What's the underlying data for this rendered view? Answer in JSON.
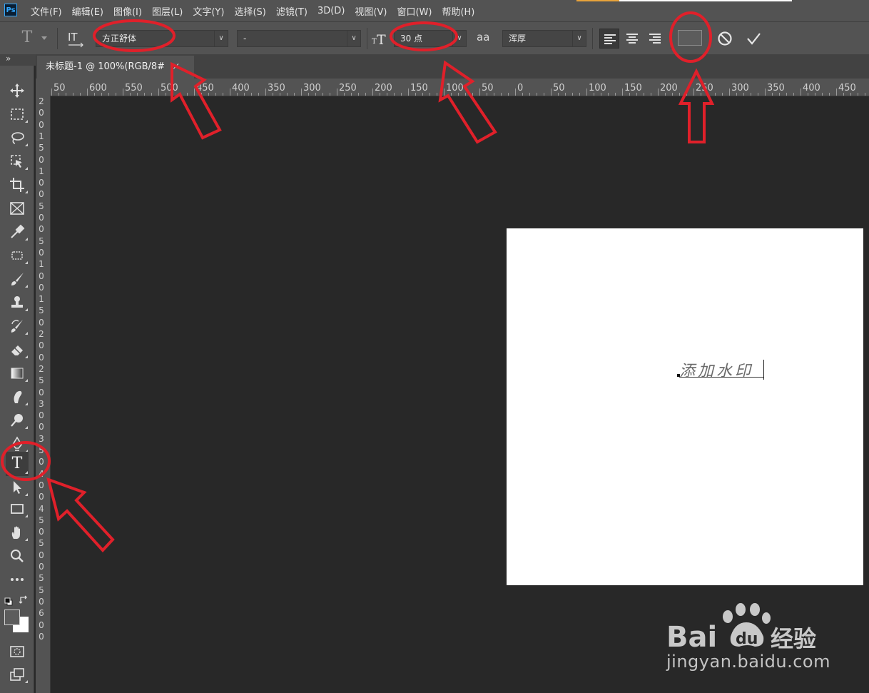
{
  "app": {
    "logo": "Ps"
  },
  "menu": {
    "items": [
      "文件(F)",
      "编辑(E)",
      "图像(I)",
      "图层(L)",
      "文字(Y)",
      "选择(S)",
      "滤镜(T)",
      "3D(D)",
      "视图(V)",
      "窗口(W)",
      "帮助(H)"
    ]
  },
  "options": {
    "tool_icon": "T",
    "orientation_icon": "text-orientation-icon",
    "font_family": "方正舒体",
    "font_style": "-",
    "font_size": "30 点",
    "antialias_label": "aa",
    "antialias_value": "浑厚",
    "text_color": "#5c5c5c",
    "cancel_icon": "cancel-icon",
    "commit_icon": "commit-check-icon"
  },
  "document": {
    "tab_title": "未标题-1 @ 100%(RGB/8#",
    "tab_close": "×",
    "canvas_text": "添加水印"
  },
  "toolbox": {
    "expand_label": "»",
    "tools": [
      "move-tool",
      "marquee-tool",
      "lasso-tool",
      "object-select-tool",
      "crop-tool",
      "frame-tool",
      "eyedropper-tool",
      "patch-tool",
      "brush-tool",
      "stamp-tool",
      "history-brush-tool",
      "eraser-tool",
      "gradient-tool",
      "smudge-tool",
      "dodge-tool",
      "pen-tool",
      "type-tool",
      "path-select-tool",
      "rectangle-tool",
      "hand-tool",
      "zoom-tool",
      "more-tools",
      "default-colors",
      "swap-colors",
      "foreground-color",
      "quick-mask",
      "screen-mode"
    ]
  },
  "rulers": {
    "h_labels": [
      "50",
      "600",
      "550",
      "500",
      "450",
      "400",
      "350",
      "300",
      "250",
      "200",
      "150",
      "100",
      "50",
      "0",
      "50",
      "100",
      "150",
      "200",
      "250",
      "300",
      "350",
      "400",
      "450"
    ],
    "v_digits": [
      "2",
      "0",
      "0",
      "1",
      "5",
      "0",
      "1",
      "0",
      "0",
      "5",
      "0",
      "0",
      "5",
      "0",
      "1",
      "0",
      "0",
      "1",
      "5",
      "0",
      "2",
      "0",
      "0",
      "2",
      "5",
      "0",
      "3",
      "0",
      "0",
      "3",
      "5",
      "0",
      "4",
      "0",
      "0",
      "4",
      "5",
      "0",
      "5",
      "0",
      "0",
      "5",
      "5",
      "0",
      "6",
      "0",
      "0"
    ]
  },
  "watermark": {
    "brand_ba": "Bai",
    "brand_du": "du",
    "brand_cn": "经验",
    "url": "jingyan.baidu.com"
  },
  "colors": {
    "annotation_red": "#e0202a",
    "accent": "#31a8ff"
  }
}
